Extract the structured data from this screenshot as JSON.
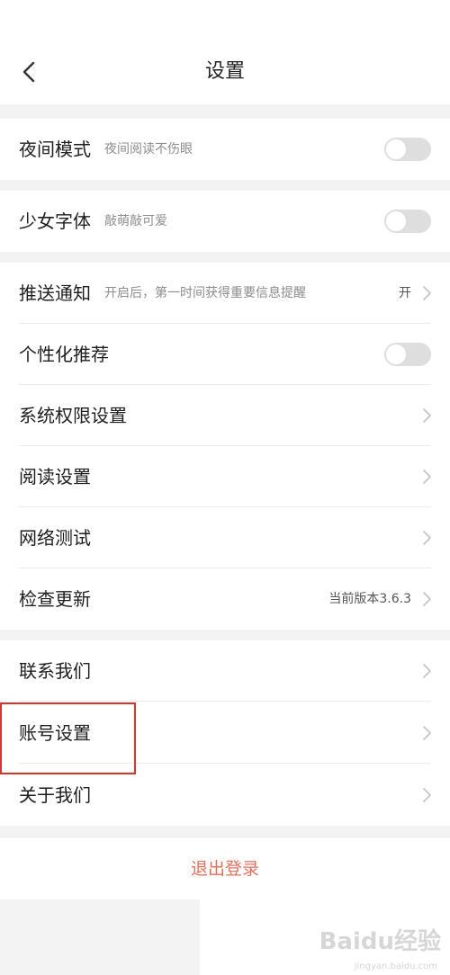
{
  "header": {
    "title": "设置",
    "back_icon": "chevron-left-icon"
  },
  "group1": {
    "label": "夜间模式",
    "subtitle": "夜间阅读不伤眼",
    "toggle_on": false
  },
  "group2": {
    "label": "少女字体",
    "subtitle": "敲萌敲可爱",
    "toggle_on": false
  },
  "group3": {
    "push": {
      "label": "推送通知",
      "subtitle": "开启后，第一时间获得重要信息提醒",
      "value": "开"
    },
    "personalized": {
      "label": "个性化推荐",
      "toggle_on": false
    },
    "permissions": {
      "label": "系统权限设置"
    },
    "reading": {
      "label": "阅读设置"
    },
    "network": {
      "label": "网络测试"
    },
    "update": {
      "label": "检查更新",
      "value": "当前版本3.6.3"
    }
  },
  "group4": {
    "contact": {
      "label": "联系我们"
    },
    "account": {
      "label": "账号设置"
    },
    "about": {
      "label": "关于我们"
    }
  },
  "logout": {
    "label": "退出登录"
  },
  "watermark": {
    "brand": "Baidu经验",
    "url": "jingyan.baidu.com"
  },
  "colors": {
    "logout_text": "#e2715b",
    "highlight_border": "#d9332b",
    "toggle_off": "#dedede"
  }
}
